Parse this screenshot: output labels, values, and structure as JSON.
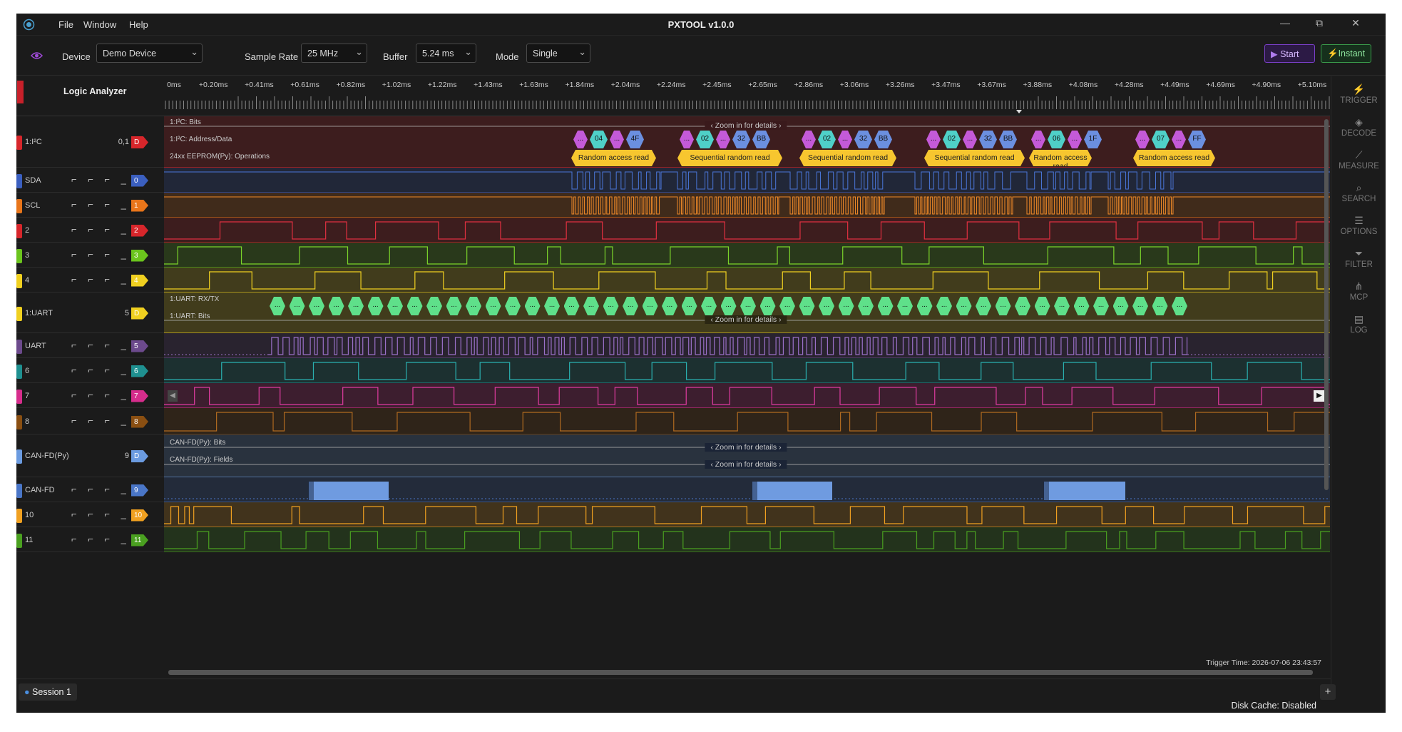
{
  "app": {
    "title": "PXTOOL v1.0.0",
    "menu": [
      "File",
      "Window",
      "Help"
    ]
  },
  "window_controls": [
    "—",
    "⧉",
    "✕"
  ],
  "toolbar": {
    "device_label": "Device",
    "device_value": "Demo Device",
    "rate_label": "Sample Rate",
    "rate_value": "25 MHz",
    "buffer_label": "Buffer",
    "buffer_value": "5.24 ms",
    "mode_label": "Mode",
    "mode_value": "Single",
    "start_label": "Start",
    "instant_label": "Instant"
  },
  "panel_title": "Logic Analyzer",
  "ruler_labels": [
    "0ms",
    "+0.20ms",
    "+0.41ms",
    "+0.61ms",
    "+0.82ms",
    "+1.02ms",
    "+1.22ms",
    "+1.43ms",
    "+1.63ms",
    "+1.84ms",
    "+2.04ms",
    "+2.24ms",
    "+2.45ms",
    "+2.65ms",
    "+2.86ms",
    "+3.06ms",
    "+3.26ms",
    "+3.47ms",
    "+3.67ms",
    "+3.88ms",
    "+4.08ms",
    "+4.28ms",
    "+4.49ms",
    "+4.69ms",
    "+4.90ms",
    "+5.10ms"
  ],
  "channels": [
    {
      "name": "1:I²C",
      "num": "0,1",
      "tag": "D",
      "kind": "decoder",
      "color": "#d7262b"
    },
    {
      "name": "SDA",
      "tag": "0",
      "color": "#3b5fbf"
    },
    {
      "name": "SCL",
      "tag": "1",
      "color": "#e8751a"
    },
    {
      "name": "2",
      "tag": "2",
      "color": "#d7262b"
    },
    {
      "name": "3",
      "tag": "3",
      "color": "#6bc41d"
    },
    {
      "name": "4",
      "tag": "4",
      "color": "#f0d020"
    },
    {
      "name": "1:UART",
      "num": "5",
      "tag": "D",
      "kind": "decoder",
      "color": "#f0d020"
    },
    {
      "name": "UART",
      "tag": "5",
      "color": "#6c4a8c"
    },
    {
      "name": "6",
      "tag": "6",
      "color": "#1f9090"
    },
    {
      "name": "7",
      "tag": "7",
      "color": "#d62d8c"
    },
    {
      "name": "8",
      "tag": "8",
      "color": "#8a4f12"
    },
    {
      "name": "CAN-FD(Py)",
      "num": "9",
      "tag": "D",
      "kind": "decoder",
      "color": "#6b9be0"
    },
    {
      "name": "CAN-FD",
      "tag": "9",
      "color": "#4a76c7"
    },
    {
      "name": "10",
      "tag": "10",
      "color": "#f0a020"
    },
    {
      "name": "11",
      "tag": "11",
      "color": "#4aa020"
    }
  ],
  "edge_glyphs": "⌐ ⌐ ⌐ _ ⌶",
  "i2c": {
    "bits_label": "1:I²C: Bits",
    "addr_label": "1:I²C: Address/Data",
    "ops_label": "24xx EEPROM(Py): Operations",
    "zoom_text": "Zoom in for details",
    "ops": [
      "Random access read",
      "Sequential random read",
      "Sequential random read",
      "Sequential random read",
      "Random access read",
      "Random access read"
    ],
    "bytes": [
      [
        "...",
        "04",
        "...",
        "4F"
      ],
      [
        "...",
        "02",
        "...",
        "32",
        "BB"
      ],
      [
        "...",
        "02",
        "...",
        "32",
        "BB"
      ],
      [
        "...",
        "02",
        "...",
        "32",
        "BB"
      ],
      [
        "...",
        "06",
        "...",
        "1F"
      ],
      [
        "...",
        "07",
        "...",
        "FF"
      ]
    ]
  },
  "uart": {
    "rxtx_label": "1:UART: RX/TX",
    "bits_label": "1:UART: Bits",
    "zoom_text": "Zoom in for details",
    "cell": "..."
  },
  "canfd": {
    "bits_label": "CAN-FD(Py): Bits",
    "fields_label": "CAN-FD(Py): Fields",
    "zoom_text": "Zoom in for details"
  },
  "trigger_time": "Trigger Time: 2026-07-06 23:43:57",
  "sidebar": [
    {
      "label": "TRIGGER",
      "icon": "lightning-icon"
    },
    {
      "label": "DECODE",
      "icon": "layers-icon"
    },
    {
      "label": "MEASURE",
      "icon": "ruler-icon"
    },
    {
      "label": "SEARCH",
      "icon": "search-icon"
    },
    {
      "label": "OPTIONS",
      "icon": "sliders-icon"
    },
    {
      "label": "FILTER",
      "icon": "filter-icon"
    },
    {
      "label": "MCP",
      "icon": "network-icon"
    },
    {
      "label": "LOG",
      "icon": "document-icon"
    }
  ],
  "session_tab": "Session 1",
  "disk_cache": "Disk Cache: Disabled",
  "plus_label": "+"
}
